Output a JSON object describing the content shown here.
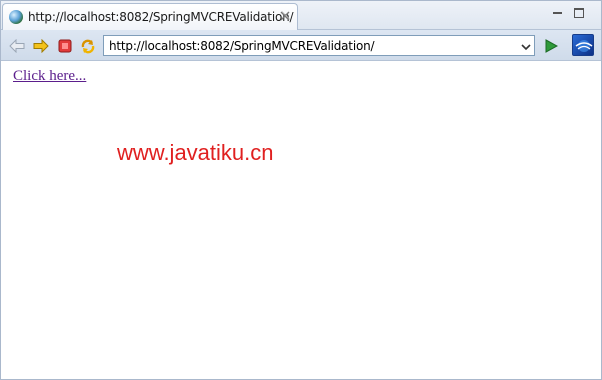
{
  "tab": {
    "title": "http://localhost:8082/SpringMVCREValidation/",
    "icon": "globe-icon",
    "close_icon": "close-icon"
  },
  "window_controls": [
    "minimize-icon",
    "maximize-icon"
  ],
  "toolbar": {
    "buttons": [
      "back-arrow-icon",
      "forward-arrow-icon",
      "stop-icon",
      "refresh-icon"
    ],
    "address": "http://localhost:8082/SpringMVCREValidation/",
    "go_icon": "play-icon",
    "extra_icon": "eclipse-icon"
  },
  "content": {
    "link_text": "Click here...",
    "watermark": "www.javatiku.cn"
  },
  "colors": {
    "link": "#5b1e8c",
    "watermark": "#e02020",
    "stop": "#e23b3b",
    "forward": "#f0b400",
    "go": "#2f9a3a"
  }
}
